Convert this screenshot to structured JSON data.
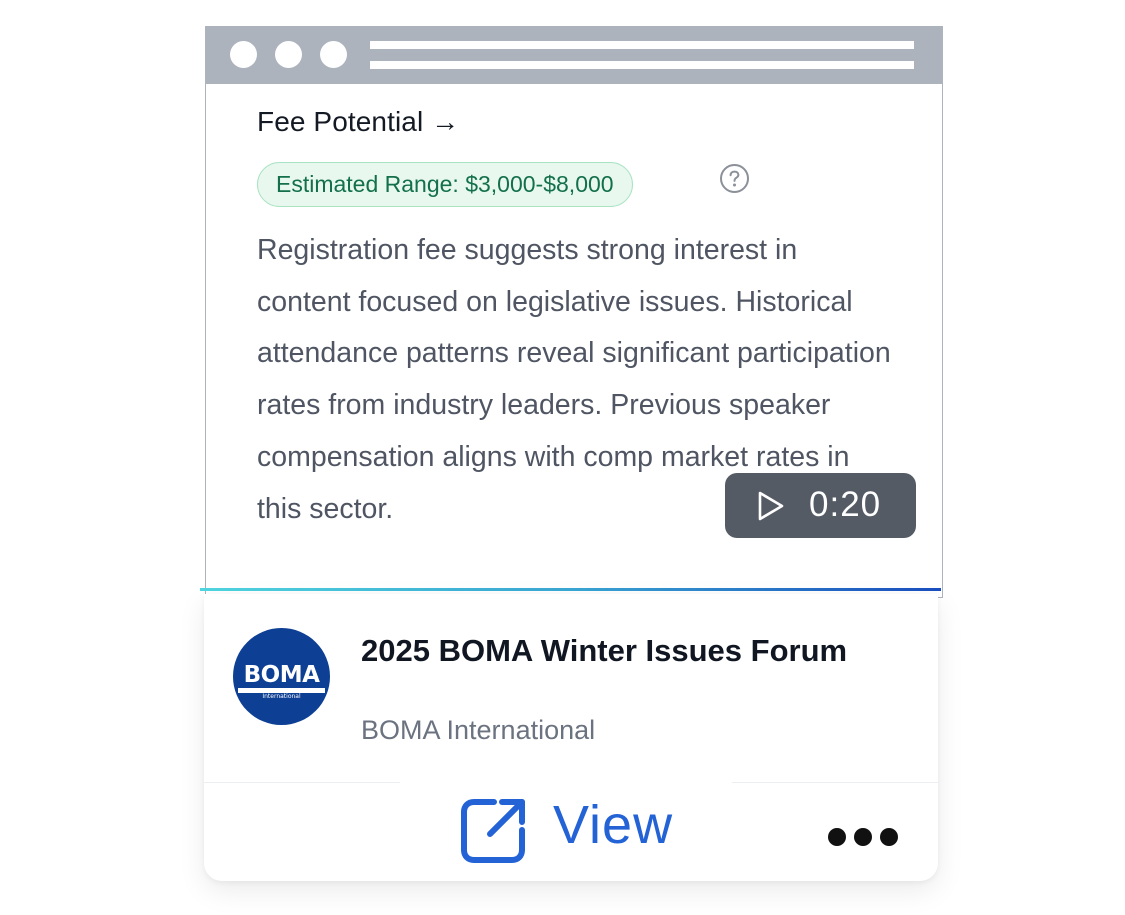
{
  "fee_section": {
    "title": "Fee Potential →",
    "range_badge": "Estimated Range: $3,000-$8,000",
    "help_icon": "question-circle-icon",
    "description": "Registration fee suggests strong interest in content focused on legislative issues. Historical attendance patterns reveal significant participation rates from industry leaders. Previous speaker compensation aligns with comp market rates in this sector."
  },
  "video": {
    "icon": "play-icon",
    "time": "0:20"
  },
  "event": {
    "logo_text": "BOMA",
    "logo_subtext": "International",
    "title": "2025 BOMA Winter Issues Forum",
    "organizer": "BOMA International"
  },
  "actions": {
    "view_label": "View",
    "view_icon": "external-link-icon",
    "more_icon": "more-dots-icon"
  },
  "colors": {
    "badge_text": "#13704a",
    "badge_bg": "#e8f8ef",
    "link_blue": "#2463d6",
    "logo_blue": "#0d3f94"
  }
}
